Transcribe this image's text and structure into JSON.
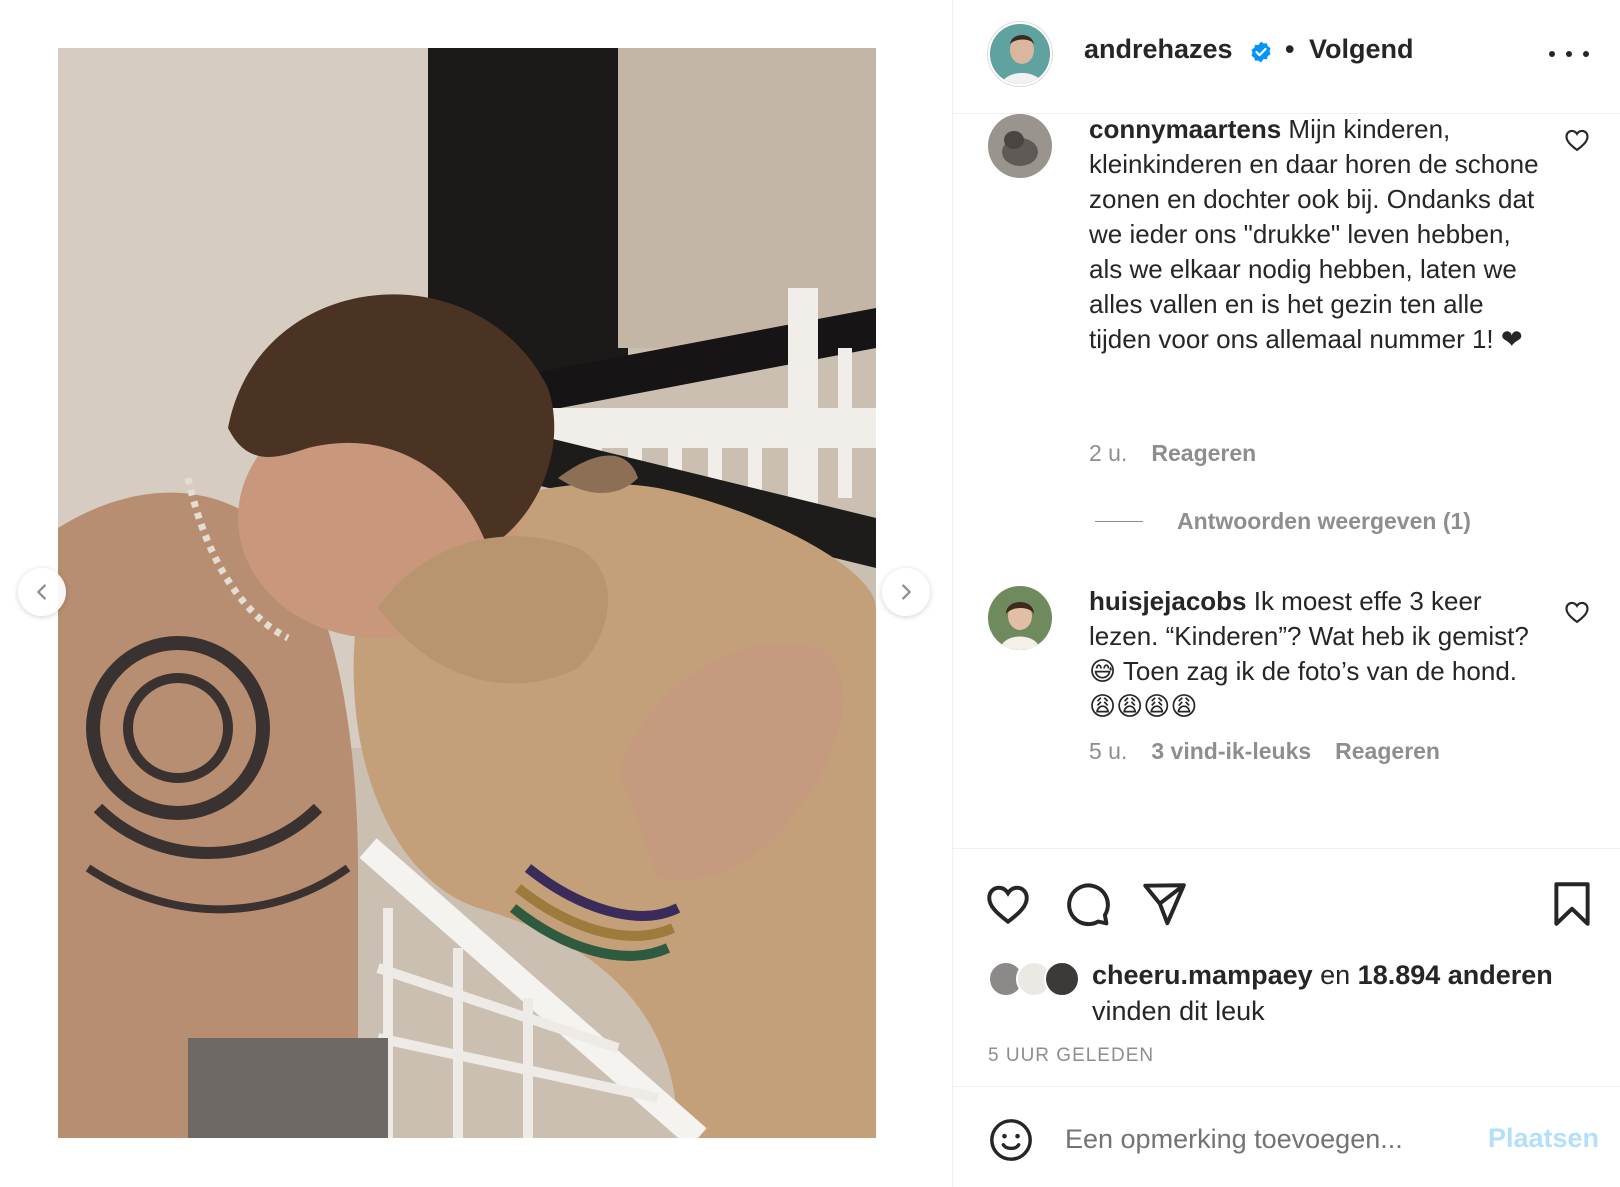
{
  "post": {
    "author": "andrehazes",
    "separator": "•",
    "follow_state": "Volgend"
  },
  "comments": [
    {
      "user": "connymaartens",
      "text": "Mijn kinderen, kleinkinderen en daar horen de schone zonen en dochter ook bij. Ondanks dat we ieder ons \"drukke\" leven hebben, als we elkaar nodig hebben, laten we alles vallen en is het gezin ten alle tijden voor ons allemaal nummer 1! ❤",
      "time": "2 u.",
      "reply_label": "Reageren",
      "view_replies": "Antwoorden weergeven (1)"
    },
    {
      "user": "huisjejacobs",
      "text": "Ik moest effe 3 keer lezen. “Kinderen”? Wat heb ik gemist? 😅 Toen zag ik de foto’s van de hond. 😩😩😩😩",
      "time": "5 u.",
      "likes": "3 vind-ik-leuks",
      "reply_label": "Reageren"
    }
  ],
  "likes": {
    "first_liker": "cheeru.mampaey",
    "connector": " en ",
    "others": "18.894 anderen",
    "suffix": "vinden dit leuk"
  },
  "timestamp": "5 UUR GELEDEN",
  "comment_box": {
    "placeholder": "Een opmerking toevoegen...",
    "post_label": "Plaatsen"
  },
  "colors": {
    "accent_disabled": "#b2dffc",
    "verified": "#0095f6",
    "secondary_text": "#8e8e8e"
  }
}
